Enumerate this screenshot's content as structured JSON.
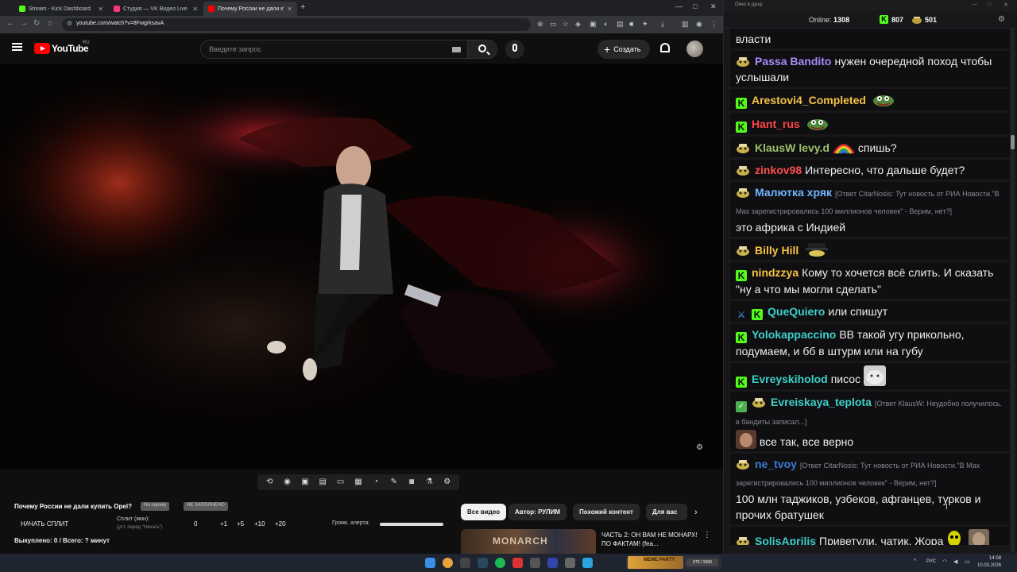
{
  "browser": {
    "tabs": [
      {
        "title": "Stream - Kick Dashboard",
        "favicon_color": "#53fc18"
      },
      {
        "title": "Студия — VK Видео Live",
        "favicon_color": "#ff3377"
      },
      {
        "title": "Почему России не дали купить",
        "favicon_color": "#ff0000"
      }
    ],
    "url": "youtube.com/watch?v=8FwgrksavA"
  },
  "youtube": {
    "brand": "YouTube",
    "region": "RU",
    "search_placeholder": "Введите запрос",
    "create_label": "Создать",
    "video_title": "Почему России не дали купить Opel?",
    "pills": [
      "На оценку",
      "НЕ ЗАПОЛНЕНО"
    ],
    "split_button": "НАЧАТЬ СПЛИТ",
    "split_label": "Сплит (мин):",
    "split_hint": "(уст. перед \"Начать\")",
    "split_value": "0",
    "split_steps": [
      "+1",
      "+5",
      "+10",
      "+20"
    ],
    "alert_volume_label": "Громк. алерта:",
    "alert_volume_fraction": 1.0,
    "bought": "Выкуплено: 0 / Всего: ? минут",
    "chips": [
      "Все видео",
      "Автор: РУЛИМ",
      "Похожий контент",
      "Для вас"
    ],
    "rec_title": "ЧАСТЬ 2: ОН ВАМ НЕ МОНАРХ! ПО ФАКТАМ! (fea...",
    "rec_thumb_text": "MONARCH"
  },
  "chat": {
    "window_title": "Окно в душу",
    "online_label": "Online:",
    "online_count": "1308",
    "kick_count": "807",
    "emote_count": "501",
    "messages": [
      {
        "text": "власти"
      },
      {
        "badges": [
          "emo"
        ],
        "user": "Passa Bandito",
        "color": "#a78bfa",
        "text": "нужен очередной поход чтобы услышали"
      },
      {
        "badges": [
          "kick"
        ],
        "user": "Arestovi4_Completed",
        "color": "#f7c245",
        "text": "",
        "emote": "pepe"
      },
      {
        "badges": [
          "kick"
        ],
        "user": "Hant_rus",
        "color": "#ff4646",
        "text": "",
        "emote": "pepe"
      },
      {
        "badges": [
          "emo"
        ],
        "user": "KlausW",
        "color": "#9fc26c",
        "user2": "levy.d",
        "color2": "#9fc26c",
        "text": "спишь?",
        "emote_before": "rainbow"
      },
      {
        "badges": [
          "emo"
        ],
        "user": "zinkov98",
        "color": "#ff4d4d",
        "text": "Интересно, что дальше будет?"
      },
      {
        "badges": [
          "emo"
        ],
        "user": "Малютка хряк",
        "color": "#6fb6ff",
        "reply": "[Ответ CitarNosis: Тут новость от РИА Новости.\"В Мах зарегистрировались 100 миллионов человек\" - Верим, нет?]",
        "text": "это африка с Индией"
      },
      {
        "badges": [
          "emo"
        ],
        "user": "Billy Hill",
        "color": "#f7c245",
        "text": "",
        "emote": "hat"
      },
      {
        "badges": [
          "kick"
        ],
        "user": "nindzzya",
        "color": "#f7c245",
        "text": "Кому то хочется всё слить. И сказать \"ну а что мы могли сделать\""
      },
      {
        "badges": [
          "sword",
          "kick"
        ],
        "user": "QueQuiero",
        "color": "#3fd0c9",
        "text": "или спишут"
      },
      {
        "badges": [
          "kick"
        ],
        "user": "Yolokappaccino",
        "color": "#3fd0c9",
        "text": "ВВ такой угу прикольно, подумаем, и бб в штурм или на губу"
      },
      {
        "badges": [
          "kick"
        ],
        "user": "Evreyskiholod",
        "color": "#3fd0c9",
        "text": "писос",
        "emote": "cat"
      },
      {
        "badges": [
          "check",
          "emo"
        ],
        "user": "Evreiskaya_teplota",
        "color": "#3fd0c9",
        "reply": "[Ответ KlausW: Неудобно получилось. в бандиты записал...]",
        "text": "все так, все верно",
        "emote_before": "face"
      },
      {
        "badges": [
          "emo"
        ],
        "user": "ne_tvoy",
        "color": "#3a7bd5",
        "reply": "[Ответ CitarNosis: Тут новость от РИА Новости.\"В Мах зарегистрировались 100 миллионов человек\" - Верим, нет?]",
        "text": "100 млн таджиков, узбеков, афганцев, турков и прочих братушек"
      },
      {
        "badges": [
          "emo"
        ],
        "user": "SolisAprilis",
        "color": "#3fd0c9",
        "text": "Приветули, чатик, Жора",
        "emote": "pair"
      }
    ]
  },
  "taskbar": {
    "tray_lang": "РУС",
    "time": "14:08",
    "date": "10.03.2026",
    "widget_label": "MEME PARTY",
    "widget_progress": "675 / 1500"
  },
  "colors": {
    "kick_green": "#53fc18",
    "youtube_red": "#ff0000"
  }
}
